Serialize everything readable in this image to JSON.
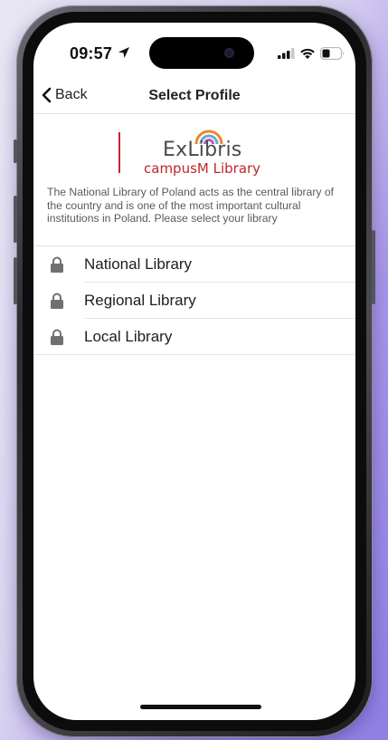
{
  "status_bar": {
    "time": "09:57",
    "icons": [
      "location-arrow-icon",
      "signal-icon",
      "wifi-icon",
      "battery-icon"
    ]
  },
  "nav": {
    "back_label": "Back",
    "title": "Select Profile"
  },
  "logo": {
    "brand": "ExLibris",
    "product": "campusM Library",
    "colors": {
      "red": "#c0262c",
      "grey": "#4a4a4a"
    }
  },
  "description": "The National Library  of Poland acts as the central library of the country and is one of the most important cultural institutions in Poland. Please select your library",
  "profiles": [
    {
      "label": "National Library",
      "icon": "lock-icon"
    },
    {
      "label": "Regional Library",
      "icon": "lock-icon"
    },
    {
      "label": "Local Library",
      "icon": "lock-icon"
    }
  ]
}
